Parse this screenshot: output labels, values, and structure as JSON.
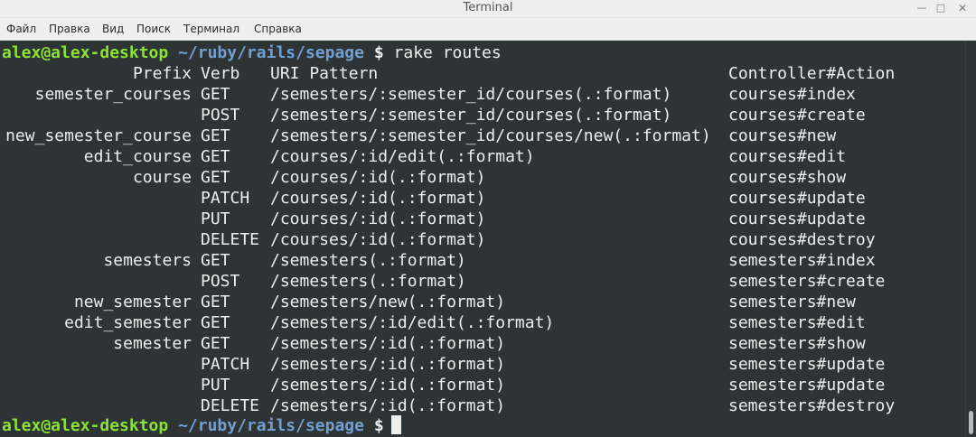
{
  "window": {
    "title": "Terminal",
    "controls": {
      "minimize": "—",
      "maximize": "□",
      "close": "✕"
    }
  },
  "menubar": {
    "items": [
      {
        "label": "Файл"
      },
      {
        "label": "Правка"
      },
      {
        "label": "Вид"
      },
      {
        "label": "Поиск"
      },
      {
        "label": "Терминал"
      },
      {
        "label": "Справка"
      }
    ]
  },
  "terminal": {
    "prompt": {
      "user_host": "alex@alex-desktop",
      "path": "~/ruby/rails/sepage",
      "dollar": "$"
    },
    "command": "rake routes",
    "header": {
      "prefix": "Prefix",
      "verb": "Verb",
      "uri": "URI Pattern",
      "action": "Controller#Action"
    },
    "rows": [
      {
        "prefix": "semester_courses",
        "verb": "GET",
        "uri": "/semesters/:semester_id/courses(.:format)",
        "action": "courses#index"
      },
      {
        "prefix": "",
        "verb": "POST",
        "uri": "/semesters/:semester_id/courses(.:format)",
        "action": "courses#create"
      },
      {
        "prefix": "new_semester_course",
        "verb": "GET",
        "uri": "/semesters/:semester_id/courses/new(.:format)",
        "action": "courses#new"
      },
      {
        "prefix": "edit_course",
        "verb": "GET",
        "uri": "/courses/:id/edit(.:format)",
        "action": "courses#edit"
      },
      {
        "prefix": "course",
        "verb": "GET",
        "uri": "/courses/:id(.:format)",
        "action": "courses#show"
      },
      {
        "prefix": "",
        "verb": "PATCH",
        "uri": "/courses/:id(.:format)",
        "action": "courses#update"
      },
      {
        "prefix": "",
        "verb": "PUT",
        "uri": "/courses/:id(.:format)",
        "action": "courses#update"
      },
      {
        "prefix": "",
        "verb": "DELETE",
        "uri": "/courses/:id(.:format)",
        "action": "courses#destroy"
      },
      {
        "prefix": "semesters",
        "verb": "GET",
        "uri": "/semesters(.:format)",
        "action": "semesters#index"
      },
      {
        "prefix": "",
        "verb": "POST",
        "uri": "/semesters(.:format)",
        "action": "semesters#create"
      },
      {
        "prefix": "new_semester",
        "verb": "GET",
        "uri": "/semesters/new(.:format)",
        "action": "semesters#new"
      },
      {
        "prefix": "edit_semester",
        "verb": "GET",
        "uri": "/semesters/:id/edit(.:format)",
        "action": "semesters#edit"
      },
      {
        "prefix": "semester",
        "verb": "GET",
        "uri": "/semesters/:id(.:format)",
        "action": "semesters#show"
      },
      {
        "prefix": "",
        "verb": "PATCH",
        "uri": "/semesters/:id(.:format)",
        "action": "semesters#update"
      },
      {
        "prefix": "",
        "verb": "PUT",
        "uri": "/semesters/:id(.:format)",
        "action": "semesters#update"
      },
      {
        "prefix": "",
        "verb": "DELETE",
        "uri": "/semesters/:id(.:format)",
        "action": "semesters#destroy"
      }
    ]
  },
  "colors": {
    "terminal_bg": "#2e3436",
    "terminal_fg": "#eeeeec",
    "prompt_user": "#8ae234",
    "prompt_path": "#729fcf"
  }
}
